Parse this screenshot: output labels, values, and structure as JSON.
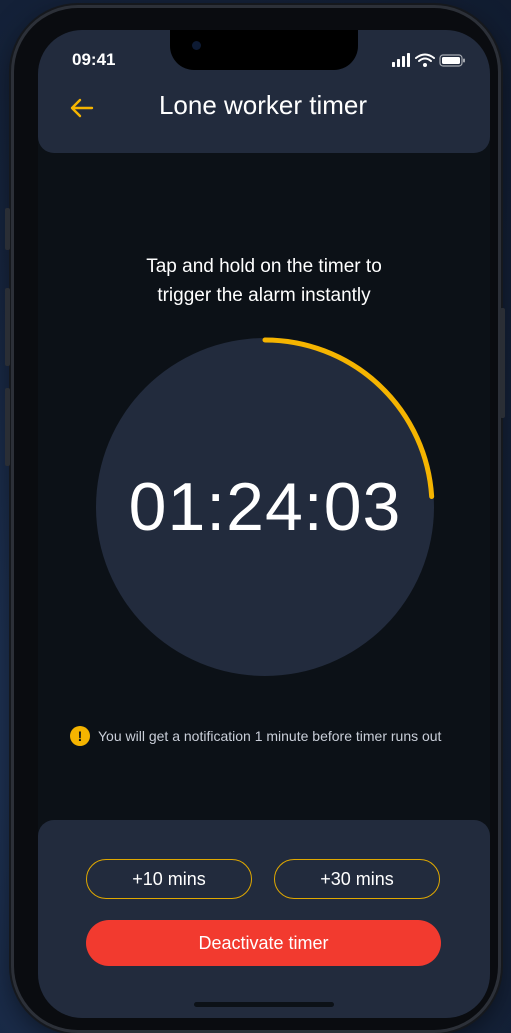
{
  "status_bar": {
    "time": "09:41"
  },
  "header": {
    "back_icon": "arrow-left-icon",
    "title": "Lone worker timer"
  },
  "instruction": {
    "line1": "Tap and hold on the timer to",
    "line2": "trigger the alarm instantly"
  },
  "timer": {
    "display": "01:24:03",
    "remaining_fraction": 0.24,
    "ring_color": "#f5b400"
  },
  "notice": {
    "icon": "exclamation-icon",
    "text": "You will get a notification 1 minute before timer runs out"
  },
  "actions": {
    "add_10_label": "+10 mins",
    "add_30_label": "+30 mins",
    "deactivate_label": "Deactivate timer"
  },
  "colors": {
    "accent": "#f5b400",
    "danger": "#f23a2f",
    "panel": "#222b3d",
    "background": "#0c1117"
  }
}
